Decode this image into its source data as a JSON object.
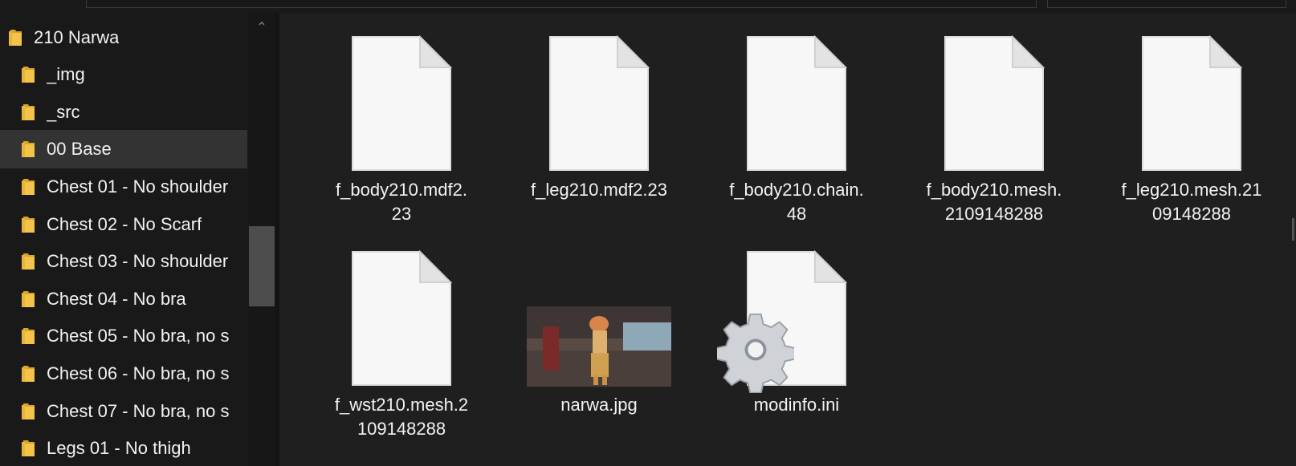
{
  "sidebar": {
    "items": [
      {
        "label": "210 Narwa",
        "selected": false,
        "icon": "folder-icon"
      },
      {
        "label": "_img",
        "selected": false,
        "icon": "folder-icon"
      },
      {
        "label": "_src",
        "selected": false,
        "icon": "folder-icon"
      },
      {
        "label": "00 Base",
        "selected": true,
        "icon": "folder-icon"
      },
      {
        "label": "Chest 01 - No shoulder",
        "selected": false,
        "icon": "folder-icon"
      },
      {
        "label": "Chest 02 - No Scarf",
        "selected": false,
        "icon": "folder-icon"
      },
      {
        "label": "Chest 03 - No shoulder",
        "selected": false,
        "icon": "folder-icon"
      },
      {
        "label": "Chest 04 - No bra",
        "selected": false,
        "icon": "folder-icon"
      },
      {
        "label": "Chest 05 - No bra, no s",
        "selected": false,
        "icon": "folder-icon"
      },
      {
        "label": "Chest 06 - No bra, no s",
        "selected": false,
        "icon": "folder-icon"
      },
      {
        "label": "Chest 07 - No bra, no s",
        "selected": false,
        "icon": "folder-icon"
      },
      {
        "label": "Legs 01 - No thigh",
        "selected": false,
        "icon": "folder-icon"
      }
    ]
  },
  "files": [
    {
      "name": "f_body210.mdf2.\n23",
      "icon": "blank-file-icon"
    },
    {
      "name": "f_leg210.mdf2.23",
      "icon": "blank-file-icon"
    },
    {
      "name": "f_body210.chain.\n48",
      "icon": "blank-file-icon"
    },
    {
      "name": "f_body210.mesh.\n2109148288",
      "icon": "blank-file-icon"
    },
    {
      "name": "f_leg210.mesh.21\n09148288",
      "icon": "blank-file-icon"
    },
    {
      "name": "f_wst210.mesh.2\n109148288",
      "icon": "blank-file-icon"
    },
    {
      "name": "narwa.jpg",
      "icon": "image-thumbnail"
    },
    {
      "name": "modinfo.ini",
      "icon": "settings-file-icon"
    }
  ],
  "colors": {
    "background": "#191919",
    "file_area": "#1f1f1f",
    "selected_row": "#333333",
    "folder_yellow": "#f4c44a",
    "text": "#f2f2f2"
  }
}
